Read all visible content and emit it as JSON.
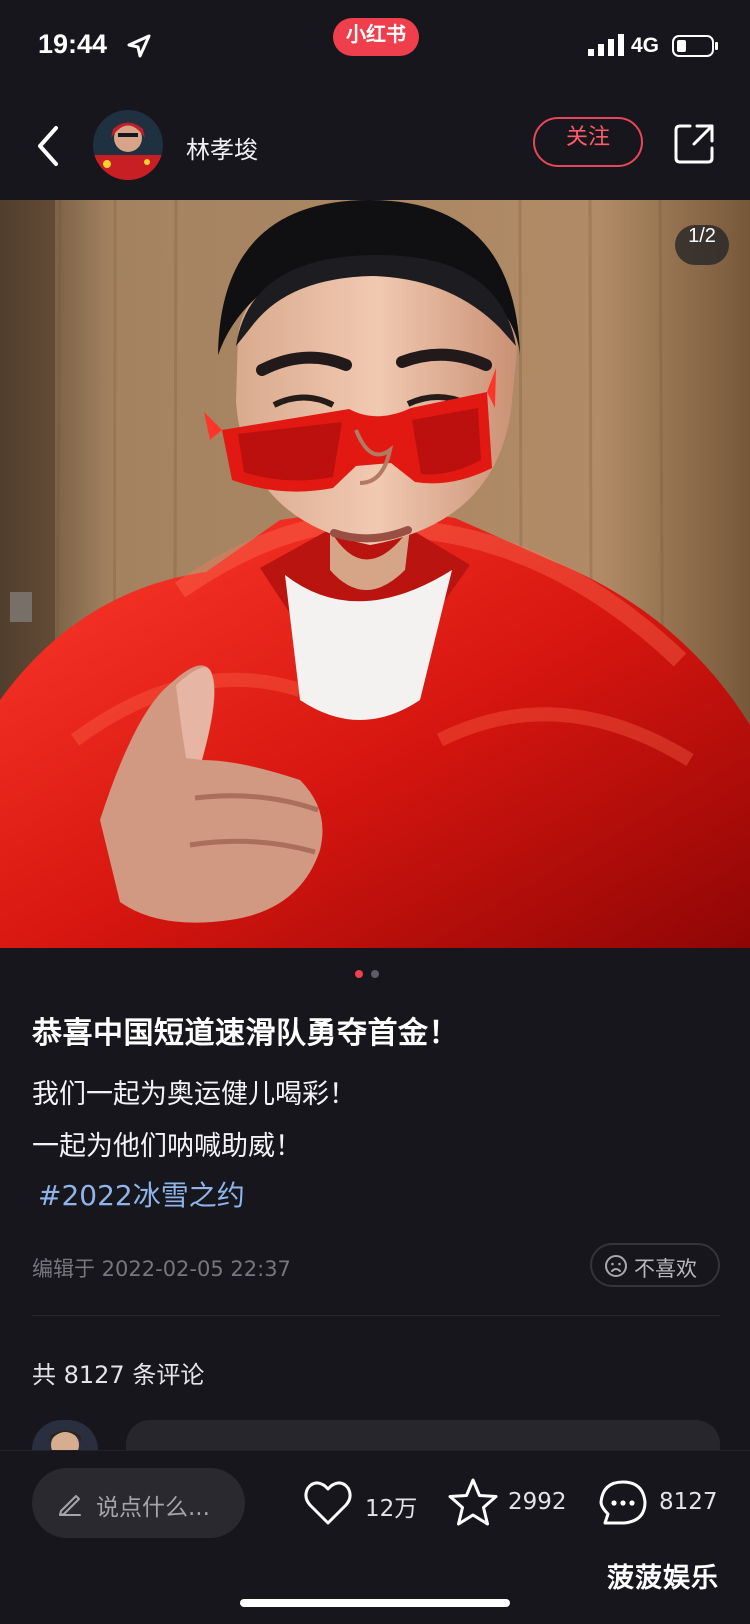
{
  "status_bar": {
    "time": "19:44",
    "app_badge": "小红书",
    "network": "4G"
  },
  "header": {
    "author_name": "林孝埈",
    "follow_label": "关注"
  },
  "photo": {
    "page_indicator": "1/2"
  },
  "post": {
    "title": "恭喜中国短道速滑队勇夺首金！",
    "lines": [
      "我们一起为奥运健儿喝彩！",
      "一起为他们呐喊助威！"
    ],
    "hashtag": "#2022冰雪之约",
    "edit_time": "编辑于  2022-02-05 22:37",
    "dislike_label": "不喜欢"
  },
  "comments": {
    "total_label": "共 8127 条评论"
  },
  "bottom_bar": {
    "input_placeholder": "说点什么...",
    "likes": "12万",
    "collects": "2992",
    "comments": "8127",
    "watermark": "菠菠娱乐"
  },
  "colors": {
    "background": "#17161c",
    "accent_red": "#ef3f4d",
    "hashtag_blue": "#8fb4ea"
  },
  "icons": [
    "location-arrow-icon",
    "signal-icon",
    "battery-icon",
    "back-arrow-icon",
    "share-icon",
    "dislike-face-icon",
    "pencil-icon",
    "heart-icon",
    "star-icon",
    "comment-bubble-icon"
  ]
}
